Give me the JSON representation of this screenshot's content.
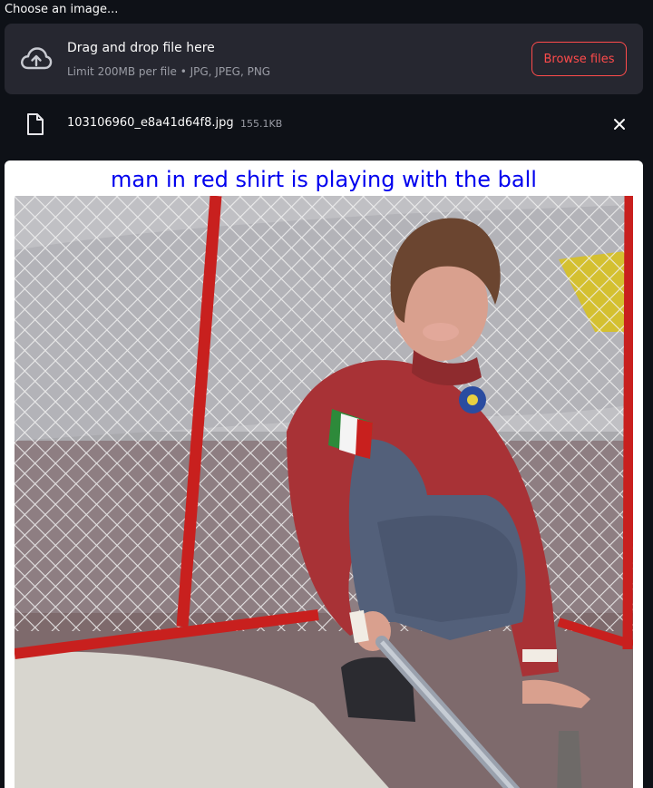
{
  "uploader": {
    "label": "Choose an image...",
    "drop_title": "Drag and drop file here",
    "limit_text": "Limit 200MB per file • JPG, JPEG, PNG",
    "browse_label": "Browse files",
    "upload_icon": "cloud-upload-icon"
  },
  "file": {
    "name": "103106960_e8a41d64f8.jpg",
    "size": "155.1KB",
    "file_icon": "file-icon",
    "close_icon": "close-icon"
  },
  "result": {
    "caption": "man in red shirt is playing with the ball"
  },
  "colors": {
    "background": "#0e1117",
    "dropzone": "#262730",
    "accent": "#ff4b4b",
    "caption": "#0000ee"
  }
}
